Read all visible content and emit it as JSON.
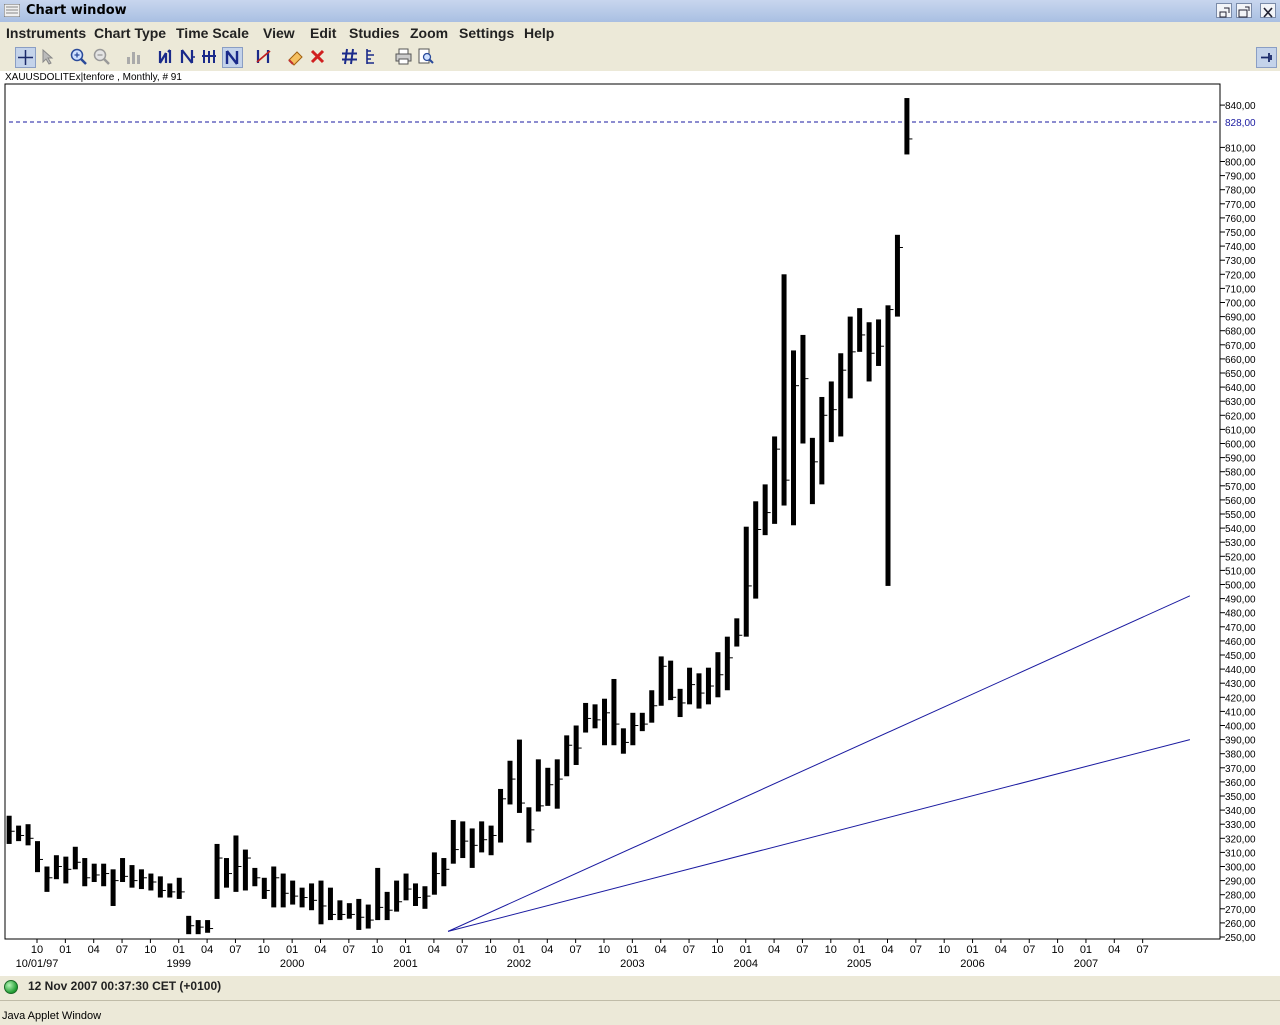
{
  "window": {
    "title": "Chart window"
  },
  "menu": [
    "Instruments",
    "Chart Type",
    "Time Scale",
    "View",
    "Edit",
    "Studies",
    "Zoom",
    "Settings",
    "Help"
  ],
  "toolbar": {
    "icons": [
      "crosshair-icon",
      "pointer-icon",
      "zoom-in-icon",
      "zoom-out-icon",
      "bar-chart-icon",
      "bars-type1-icon",
      "bars-type2-icon",
      "bars-type3-icon",
      "bars-type4-icon",
      "draw-tool-icon",
      "eraser-icon",
      "delete-icon",
      "grid-icon",
      "scale-icon",
      "print-icon",
      "print-preview-icon",
      "dock-icon"
    ]
  },
  "chart_label": "XAUUSDOLITEx|tenfore , Monthly, # 91",
  "status_text": "12 Nov 2007 00:37:30  CET (+0100)",
  "java_status": "Java Applet Window",
  "chart_data": {
    "type": "bar",
    "ylim": [
      246,
      846
    ],
    "reference_line": {
      "value": 828,
      "label": "828,00",
      "color": "#1a1aa0"
    },
    "y_ticks": [
      "840,00",
      "810,00",
      "800,00",
      "790,00",
      "780,00",
      "770,00",
      "760,00",
      "750,00",
      "740,00",
      "730,00",
      "720,00",
      "710,00",
      "700,00",
      "690,00",
      "680,00",
      "670,00",
      "660,00",
      "650,00",
      "640,00",
      "630,00",
      "620,00",
      "610,00",
      "600,00",
      "590,00",
      "580,00",
      "570,00",
      "560,00",
      "550,00",
      "540,00",
      "530,00",
      "520,00",
      "510,00",
      "500,00",
      "490,00",
      "480,00",
      "470,00",
      "460,00",
      "450,00",
      "440,00",
      "430,00",
      "420,00",
      "410,00",
      "400,00",
      "390,00",
      "380,00",
      "370,00",
      "360,00",
      "350,00",
      "340,00",
      "330,00",
      "320,00",
      "310,00",
      "300,00",
      "290,00",
      "280,00",
      "270,00",
      "260,00",
      "250,00"
    ],
    "x_ticks": [
      {
        "label": "10",
        "month_index": 0
      },
      {
        "label": "01",
        "month_index": 3
      },
      {
        "label": "04",
        "month_index": 6
      },
      {
        "label": "07",
        "month_index": 9
      },
      {
        "label": "10",
        "month_index": 12
      },
      {
        "label": "01",
        "month_index": 15
      },
      {
        "label": "04",
        "month_index": 18
      },
      {
        "label": "07",
        "month_index": 21
      },
      {
        "label": "10",
        "month_index": 24
      },
      {
        "label": "01",
        "month_index": 27
      },
      {
        "label": "04",
        "month_index": 30
      },
      {
        "label": "07",
        "month_index": 33
      },
      {
        "label": "10",
        "month_index": 36
      },
      {
        "label": "01",
        "month_index": 39
      },
      {
        "label": "04",
        "month_index": 42
      },
      {
        "label": "07",
        "month_index": 45
      },
      {
        "label": "10",
        "month_index": 48
      },
      {
        "label": "01",
        "month_index": 51
      },
      {
        "label": "04",
        "month_index": 54
      },
      {
        "label": "07",
        "month_index": 57
      },
      {
        "label": "10",
        "month_index": 60
      },
      {
        "label": "01",
        "month_index": 63
      },
      {
        "label": "04",
        "month_index": 66
      },
      {
        "label": "07",
        "month_index": 69
      },
      {
        "label": "10",
        "month_index": 72
      },
      {
        "label": "01",
        "month_index": 75
      },
      {
        "label": "04",
        "month_index": 78
      },
      {
        "label": "07",
        "month_index": 81
      },
      {
        "label": "10",
        "month_index": 84
      },
      {
        "label": "01",
        "month_index": 87
      },
      {
        "label": "04",
        "month_index": 90
      },
      {
        "label": "07",
        "month_index": 93
      },
      {
        "label": "10",
        "month_index": 96
      },
      {
        "label": "01",
        "month_index": 99
      },
      {
        "label": "04",
        "month_index": 102
      },
      {
        "label": "07",
        "month_index": 105
      },
      {
        "label": "10",
        "month_index": 108
      },
      {
        "label": "01",
        "month_index": 111
      },
      {
        "label": "04",
        "month_index": 114
      },
      {
        "label": "07",
        "month_index": 117
      }
    ],
    "x_year_labels": [
      {
        "label": "10/01/97",
        "month_index": 0
      },
      {
        "label": "1999",
        "month_index": 15
      },
      {
        "label": "2000",
        "month_index": 27
      },
      {
        "label": "2001",
        "month_index": 39
      },
      {
        "label": "2002",
        "month_index": 51
      },
      {
        "label": "2003",
        "month_index": 63
      },
      {
        "label": "2004",
        "month_index": 75
      },
      {
        "label": "2005",
        "month_index": 87
      },
      {
        "label": "2006",
        "month_index": 99
      },
      {
        "label": "2007",
        "month_index": 111
      }
    ],
    "month_range": [
      -3,
      122
    ],
    "bars": [
      [
        -3,
        316,
        336,
        325
      ],
      [
        -2,
        318,
        329,
        322
      ],
      [
        -1,
        315,
        330,
        320
      ],
      [
        0,
        296,
        318,
        305
      ],
      [
        1,
        282,
        300,
        292
      ],
      [
        2,
        291,
        308,
        300
      ],
      [
        3,
        288,
        307,
        298
      ],
      [
        4,
        298,
        314,
        303
      ],
      [
        5,
        286,
        306,
        292
      ],
      [
        6,
        289,
        302,
        294
      ],
      [
        7,
        286,
        302,
        295
      ],
      [
        8,
        272,
        298,
        290
      ],
      [
        9,
        289,
        306,
        293
      ],
      [
        10,
        285,
        301,
        290
      ],
      [
        11,
        284,
        298,
        292
      ],
      [
        12,
        283,
        295,
        289
      ],
      [
        13,
        278,
        293,
        283
      ],
      [
        14,
        278,
        288,
        282
      ],
      [
        15,
        277,
        292,
        282
      ],
      [
        16,
        252,
        265,
        258
      ],
      [
        17,
        252,
        262,
        257
      ],
      [
        18,
        253,
        262,
        256
      ],
      [
        19,
        277,
        316,
        306
      ],
      [
        20,
        285,
        306,
        295
      ],
      [
        21,
        282,
        322,
        300
      ],
      [
        22,
        283,
        312,
        306
      ],
      [
        23,
        286,
        299,
        292
      ],
      [
        24,
        277,
        292,
        283
      ],
      [
        25,
        271,
        300,
        292
      ],
      [
        26,
        271,
        295,
        281
      ],
      [
        27,
        273,
        290,
        279
      ],
      [
        28,
        271,
        285,
        278
      ],
      [
        29,
        269,
        288,
        276
      ],
      [
        30,
        259,
        290,
        272
      ],
      [
        31,
        262,
        285,
        266
      ],
      [
        32,
        262,
        276,
        266
      ],
      [
        33,
        263,
        274,
        266
      ],
      [
        34,
        255,
        277,
        264
      ],
      [
        35,
        256,
        273,
        262
      ],
      [
        36,
        262,
        299,
        271
      ],
      [
        37,
        262,
        282,
        269
      ],
      [
        38,
        268,
        290,
        275
      ],
      [
        39,
        276,
        295,
        284
      ],
      [
        40,
        272,
        288,
        278
      ],
      [
        41,
        270,
        286,
        279
      ],
      [
        42,
        280,
        310,
        295
      ],
      [
        43,
        286,
        306,
        298
      ],
      [
        44,
        302,
        333,
        312
      ],
      [
        45,
        306,
        332,
        318
      ],
      [
        46,
        299,
        327,
        315
      ],
      [
        47,
        310,
        332,
        319
      ],
      [
        48,
        308,
        329,
        322
      ],
      [
        49,
        317,
        355,
        348
      ],
      [
        50,
        344,
        375,
        362
      ],
      [
        51,
        338,
        390,
        345
      ],
      [
        52,
        317,
        342,
        326
      ],
      [
        53,
        339,
        376,
        343
      ],
      [
        54,
        343,
        370,
        358
      ],
      [
        55,
        341,
        376,
        362
      ],
      [
        56,
        364,
        393,
        386
      ],
      [
        57,
        372,
        400,
        384
      ],
      [
        58,
        395,
        416,
        405
      ],
      [
        59,
        398,
        415,
        404
      ],
      [
        60,
        386,
        419,
        409
      ],
      [
        61,
        386,
        433,
        401
      ],
      [
        62,
        380,
        398,
        388
      ],
      [
        63,
        386,
        409,
        400
      ],
      [
        64,
        396,
        409,
        401
      ],
      [
        65,
        402,
        425,
        414
      ],
      [
        66,
        414,
        449,
        442
      ],
      [
        67,
        418,
        446,
        420
      ],
      [
        68,
        406,
        426,
        416
      ],
      [
        69,
        415,
        441,
        429
      ],
      [
        70,
        412,
        437,
        423
      ],
      [
        71,
        415,
        441,
        428
      ],
      [
        72,
        420,
        452,
        436
      ],
      [
        73,
        425,
        463,
        448
      ],
      [
        74,
        456,
        476,
        464
      ],
      [
        75,
        463,
        541,
        499
      ],
      [
        76,
        490,
        559,
        539
      ],
      [
        77,
        535,
        571,
        551
      ],
      [
        78,
        543,
        605,
        596
      ],
      [
        79,
        556,
        720,
        574
      ],
      [
        80,
        542,
        666,
        641
      ],
      [
        81,
        600,
        677,
        646
      ],
      [
        82,
        557,
        604,
        587
      ],
      [
        83,
        571,
        633,
        620
      ],
      [
        84,
        601,
        644,
        624
      ],
      [
        85,
        605,
        664,
        652
      ],
      [
        86,
        632,
        690,
        665
      ],
      [
        87,
        665,
        696,
        677
      ],
      [
        88,
        644,
        686,
        664
      ],
      [
        89,
        655,
        688,
        669
      ],
      [
        90,
        499,
        698,
        695
      ],
      [
        91,
        690,
        748,
        739
      ],
      [
        92,
        805,
        845,
        816
      ]
    ],
    "trendlines": [
      {
        "from": [
          43.5,
          254
        ],
        "to": [
          122,
          492
        ],
        "color": "#1a1aa0"
      },
      {
        "from": [
          43.5,
          254
        ],
        "to": [
          122,
          390
        ],
        "color": "#1a1aa0"
      }
    ]
  }
}
